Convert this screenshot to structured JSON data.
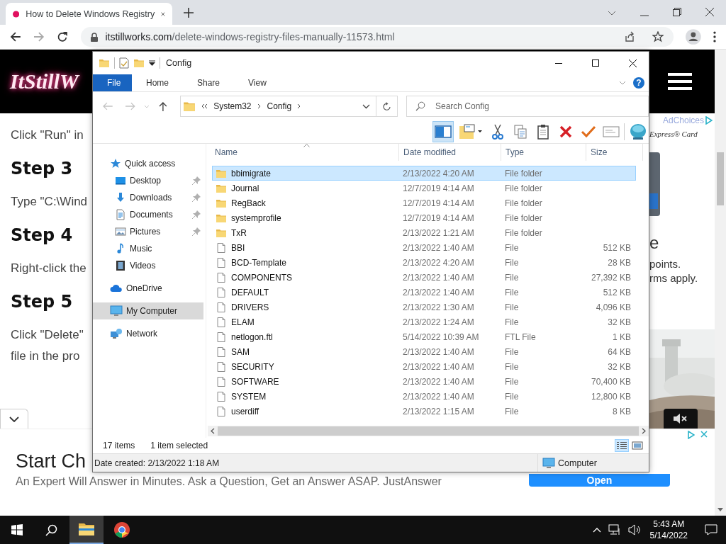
{
  "browser": {
    "tab": {
      "title": "How to Delete Windows Registry"
    },
    "url": {
      "host": "itstillworks.com",
      "path": "/delete-windows-registry-files-manually-11573.html"
    }
  },
  "page": {
    "logo": "ItStillW",
    "article": [
      {
        "kind": "para",
        "lines": [
          "Click \"Run\" in"
        ]
      },
      {
        "kind": "heading",
        "lines": [
          "Step 3"
        ]
      },
      {
        "kind": "para",
        "lines": [
          "Type \"C:\\Wind"
        ]
      },
      {
        "kind": "heading",
        "lines": [
          "Step 4"
        ]
      },
      {
        "kind": "para",
        "lines": [
          "Right-click the"
        ]
      },
      {
        "kind": "heading",
        "lines": [
          "Step 5"
        ]
      },
      {
        "kind": "para",
        "lines": [
          "Click \"Delete\"",
          "file in the pro"
        ]
      }
    ],
    "side_ad": {
      "adchoices": "AdChoices",
      "brand": "Express® Card",
      "headline": "e",
      "body": [
        "points.",
        "rms apply."
      ]
    },
    "bottom_ad": {
      "title": "Start Ch",
      "text": "An Expert Will Answer in Minutes. Ask a Question, Get an Answer ASAP. JustAnswer",
      "button": "Open"
    }
  },
  "explorer": {
    "title": "Config",
    "ribbon_tabs": [
      {
        "label": "File",
        "selected": true
      },
      {
        "label": "Home",
        "selected": false
      },
      {
        "label": "Share",
        "selected": false
      },
      {
        "label": "View",
        "selected": false
      }
    ],
    "help": "?",
    "breadcrumb": [
      "System32",
      "Config"
    ],
    "search_placeholder": "Search Config",
    "toolbar": [
      {
        "kind": "pane",
        "on": true
      },
      {
        "kind": "new-folder",
        "on": false
      },
      {
        "kind": "cut",
        "on": false
      },
      {
        "kind": "copy",
        "on": false
      },
      {
        "kind": "paste",
        "on": false
      },
      {
        "kind": "delete",
        "on": false
      },
      {
        "kind": "check",
        "on": false
      },
      {
        "kind": "rename",
        "on": false
      },
      {
        "kind": "globe",
        "on": false
      }
    ],
    "nav": [
      {
        "label": "Quick access",
        "kind": "quick-access",
        "selected": false,
        "children": [
          {
            "label": "Desktop",
            "kind": "desktop",
            "pinned": true,
            "selected": false
          },
          {
            "label": "Downloads",
            "kind": "downloads",
            "pinned": true,
            "selected": false
          },
          {
            "label": "Documents",
            "kind": "documents",
            "pinned": true,
            "selected": false
          },
          {
            "label": "Pictures",
            "kind": "pictures",
            "pinned": true,
            "selected": false
          },
          {
            "label": "Music",
            "kind": "music",
            "pinned": false,
            "selected": false
          },
          {
            "label": "Videos",
            "kind": "videos",
            "pinned": false,
            "selected": false
          }
        ]
      },
      {
        "label": "OneDrive",
        "kind": "onedrive",
        "selected": false
      },
      {
        "label": "My Computer",
        "kind": "computer",
        "selected": true
      },
      {
        "label": "Network",
        "kind": "network",
        "selected": false
      }
    ],
    "columns": [
      "Name",
      "Date modified",
      "Type",
      "Size"
    ],
    "files": [
      {
        "name": "bbimigrate",
        "date": "2/13/2022 4:20 AM",
        "type": "File folder",
        "kind": "folder",
        "selected": true
      },
      {
        "name": "Journal",
        "date": "12/7/2019 4:14 AM",
        "type": "File folder",
        "kind": "folder",
        "selected": false
      },
      {
        "name": "RegBack",
        "date": "12/7/2019 4:14 AM",
        "type": "File folder",
        "kind": "folder",
        "selected": false
      },
      {
        "name": "systemprofile",
        "date": "12/7/2019 4:14 AM",
        "type": "File folder",
        "kind": "folder",
        "selected": false
      },
      {
        "name": "TxR",
        "date": "2/13/2022 1:21 AM",
        "type": "File folder",
        "kind": "folder",
        "selected": false
      },
      {
        "name": "BBI",
        "date": "2/13/2022 1:40 AM",
        "type": "File",
        "size": "512 KB",
        "kind": "file",
        "selected": false
      },
      {
        "name": "BCD-Template",
        "date": "2/13/2022 4:20 AM",
        "type": "File",
        "size": "28 KB",
        "kind": "file",
        "selected": false
      },
      {
        "name": "COMPONENTS",
        "date": "2/13/2022 1:40 AM",
        "type": "File",
        "size": "27,392 KB",
        "kind": "file",
        "selected": false
      },
      {
        "name": "DEFAULT",
        "date": "2/13/2022 1:40 AM",
        "type": "File",
        "size": "512 KB",
        "kind": "file",
        "selected": false
      },
      {
        "name": "DRIVERS",
        "date": "2/13/2022 1:30 AM",
        "type": "File",
        "size": "4,096 KB",
        "kind": "file",
        "selected": false
      },
      {
        "name": "ELAM",
        "date": "2/13/2022 1:24 AM",
        "type": "File",
        "size": "32 KB",
        "kind": "file",
        "selected": false
      },
      {
        "name": "netlogon.ftl",
        "date": "5/14/2022 10:39 AM",
        "type": "FTL File",
        "size": "1 KB",
        "kind": "file",
        "selected": false
      },
      {
        "name": "SAM",
        "date": "2/13/2022 1:40 AM",
        "type": "File",
        "size": "64 KB",
        "kind": "file",
        "selected": false
      },
      {
        "name": "SECURITY",
        "date": "2/13/2022 1:40 AM",
        "type": "File",
        "size": "32 KB",
        "kind": "file",
        "selected": false
      },
      {
        "name": "SOFTWARE",
        "date": "2/13/2022 1:40 AM",
        "type": "File",
        "size": "70,400 KB",
        "kind": "file",
        "selected": false
      },
      {
        "name": "SYSTEM",
        "date": "2/13/2022 1:40 AM",
        "type": "File",
        "size": "12,800 KB",
        "kind": "file",
        "selected": false
      },
      {
        "name": "userdiff",
        "date": "2/13/2022 1:15 AM",
        "type": "File",
        "size": "8 KB",
        "kind": "file",
        "selected": false
      }
    ],
    "status": {
      "count": "17 items",
      "selection": "1 item selected",
      "details": "Date created: 2/13/2022 1:18 AM",
      "location": "Computer"
    },
    "view_buttons": [
      {
        "kind": "details",
        "selected": true
      },
      {
        "kind": "thumbnails",
        "selected": false
      }
    ]
  },
  "taskbar": {
    "apps": [
      {
        "kind": "explorer",
        "active": true
      },
      {
        "kind": "browser",
        "active": false
      }
    ],
    "time": "5:43 AM",
    "date": "5/14/2022"
  }
}
